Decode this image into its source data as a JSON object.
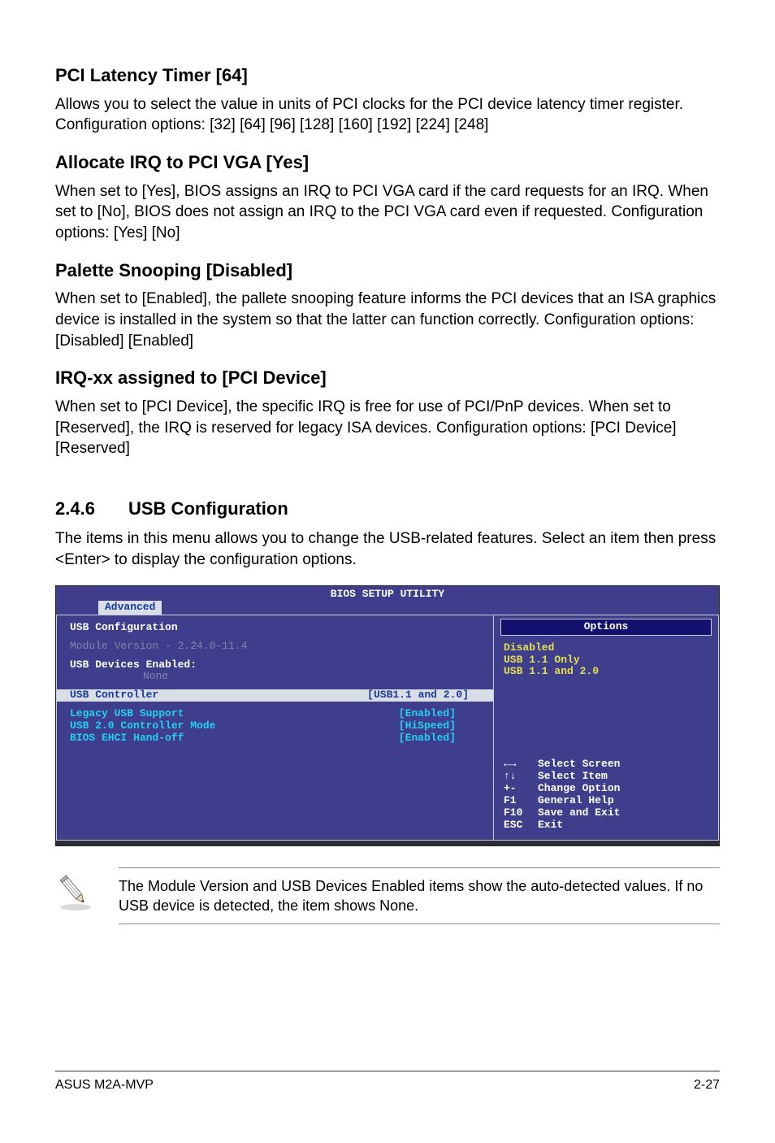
{
  "sections": {
    "pci_latency": {
      "heading": "PCI Latency Timer [64]",
      "body": "Allows you to select the value in units of PCI clocks for the PCI device latency timer register. Configuration options: [32] [64] [96] [128] [160] [192] [224] [248]"
    },
    "allocate_irq": {
      "heading": "Allocate IRQ to PCI VGA [Yes]",
      "body": "When set to [Yes], BIOS assigns an IRQ to PCI VGA card if the card requests for an IRQ. When set to [No], BIOS does not assign an IRQ to the PCI VGA card even if requested. Configuration options: [Yes] [No]"
    },
    "palette": {
      "heading": "Palette Snooping [Disabled]",
      "body": "When set to [Enabled], the pallete snooping feature informs the PCI devices that an ISA graphics device is installed in the system so that the latter can function correctly. Configuration options: [Disabled] [Enabled]"
    },
    "irqxx": {
      "heading": "IRQ-xx assigned to [PCI Device]",
      "body": "When set to [PCI Device], the specific IRQ is free for use of PCI/PnP devices. When set to [Reserved], the IRQ is reserved for legacy ISA devices. Configuration options: [PCI Device] [Reserved]"
    },
    "usb_conf": {
      "number": "2.4.6",
      "title": "USB Configuration",
      "intro": "The items in this menu allows you to change the USB-related features. Select an item then press <Enter> to display the configuration options."
    }
  },
  "bios": {
    "title": "BIOS SETUP UTILITY",
    "tab": "Advanced",
    "left": {
      "heading": "USB Configuration",
      "module_version": "Module Version - 2.24.0-11.4",
      "devices_label": "USB Devices Enabled:",
      "devices_value": "None",
      "sel_label": "USB Controller",
      "sel_value": "[USB1.1 and 2.0]",
      "rows": [
        {
          "label": "Legacy USB Support",
          "value": "[Enabled]"
        },
        {
          "label": "USB 2.0 Controller Mode",
          "value": "[HiSpeed]"
        },
        {
          "label": "BIOS EHCI Hand-off",
          "value": "[Enabled]"
        }
      ]
    },
    "right": {
      "options_heading": "Options",
      "options": [
        "Disabled",
        "USB 1.1 Only",
        "USB 1.1 and 2.0"
      ],
      "help": [
        {
          "key": "←→",
          "text": "Select Screen"
        },
        {
          "key": "↑↓",
          "text": "Select Item"
        },
        {
          "key": "+-",
          "text": "Change Option"
        },
        {
          "key": "F1",
          "text": "General Help"
        },
        {
          "key": "F10",
          "text": "Save and Exit"
        },
        {
          "key": "ESC",
          "text": "Exit"
        }
      ]
    }
  },
  "note": {
    "text": "The Module Version and USB Devices Enabled items show the auto-detected values. If no USB device is detected, the item shows None."
  },
  "footer": {
    "left": "ASUS M2A-MVP",
    "right": "2-27"
  }
}
